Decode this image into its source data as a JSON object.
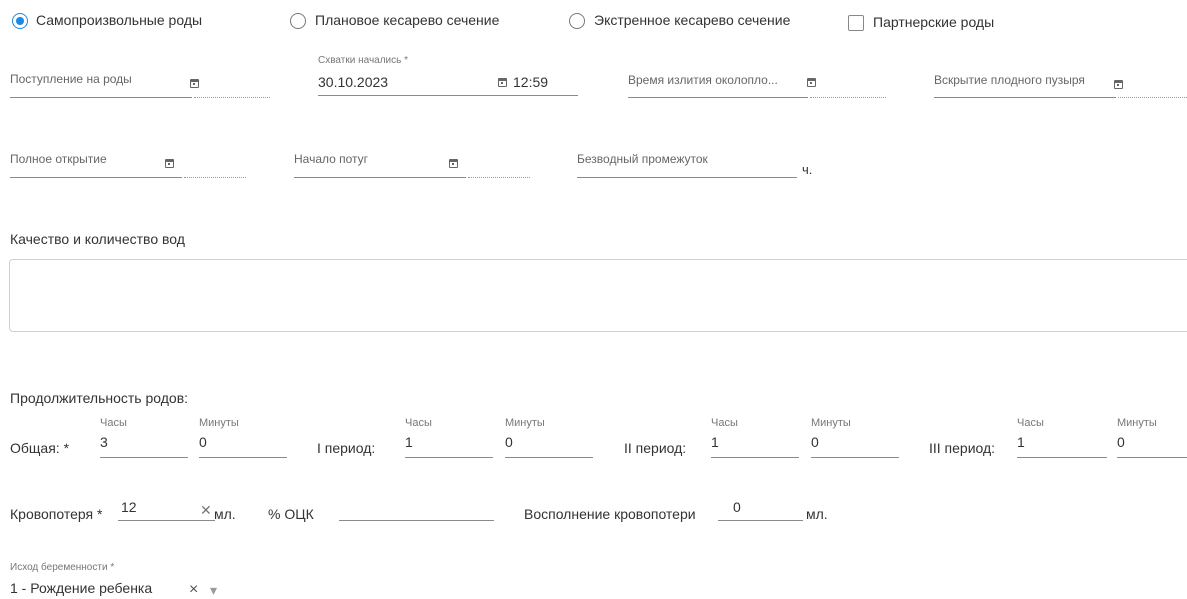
{
  "delivery_types": {
    "spontaneous": "Самопроизвольные роды",
    "planned_cesarean": "Плановое кесарево сечение",
    "emergency_cesarean": "Экстренное кесарево сечение",
    "partner_birth": "Партнерские роды"
  },
  "fields": {
    "admission_label": "Поступление на роды",
    "contractions_label": "Схватки начались *",
    "contractions_date": "30.10.2023",
    "contractions_time": "12:59",
    "amniotic_outflow_label": "Время излития околопло...",
    "amniotomy_label": "Вскрытие плодного пузыря",
    "full_dilation_label": "Полное открытие",
    "pushing_start_label": "Начало потуг",
    "anhydrous_label": "Безводный промежуток",
    "anhydrous_unit": "ч."
  },
  "waters": {
    "title": "Качество и количество вод"
  },
  "duration": {
    "title": "Продолжительность родов:",
    "hours_label": "Часы",
    "minutes_label": "Минуты",
    "total_label": "Общая: *",
    "total_hours": "3",
    "total_minutes": "0",
    "p1_label": "I период:",
    "p1_hours": "1",
    "p1_minutes": "0",
    "p2_label": "II период:",
    "p2_hours": "1",
    "p2_minutes": "0",
    "p3_label": "III период:",
    "p3_hours": "1",
    "p3_minutes": "0"
  },
  "blood": {
    "loss_label": "Кровопотеря *",
    "loss_value": "12",
    "ml_unit": "мл.",
    "ocv_label": "% ОЦК",
    "replacement_label": "Восполнение кровопотери",
    "replacement_value": "0",
    "replacement_unit": "мл."
  },
  "outcome": {
    "label": "Исход беременности *",
    "value": "1 - Рождение ребенка",
    "clear_symbol": "×",
    "dropdown_symbol": "▾"
  }
}
